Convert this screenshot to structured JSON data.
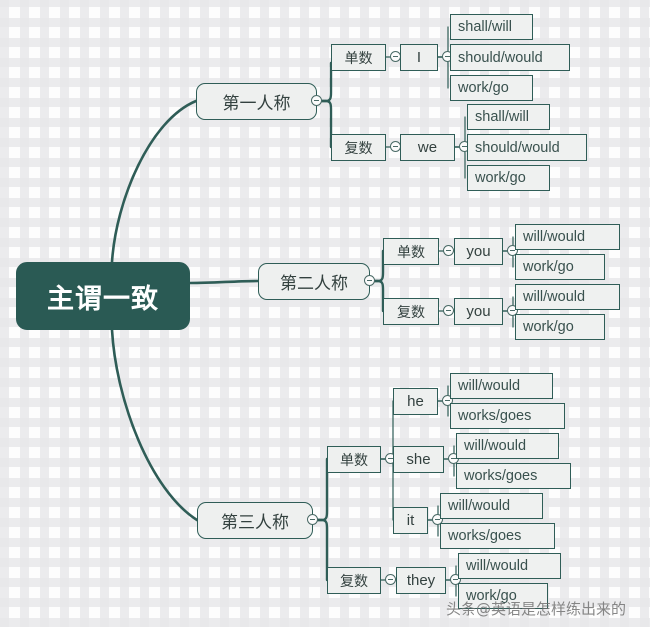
{
  "diagram": {
    "title": "主谓一致",
    "type": "mind-map",
    "colors": {
      "root_fill": "#2a5a54",
      "root_text": "#ffffff",
      "node_fill": "#eef0ef",
      "node_border": "#2f5d57",
      "node_text": "#33413f",
      "link": "#2f5d57",
      "background": "#fdfdfd"
    },
    "root": {
      "label": "主谓一致"
    },
    "branches": [
      {
        "label": "第一人称",
        "children": [
          {
            "label": "单数",
            "pronouns": [
              {
                "label": "I",
                "forms": [
                  "shall/will",
                  "should/would",
                  "work/go"
                ]
              }
            ]
          },
          {
            "label": "复数",
            "pronouns": [
              {
                "label": "we",
                "forms": [
                  "shall/will",
                  "should/would",
                  "work/go"
                ]
              }
            ]
          }
        ]
      },
      {
        "label": "第二人称",
        "children": [
          {
            "label": "单数",
            "pronouns": [
              {
                "label": "you",
                "forms": [
                  "will/would",
                  "work/go"
                ]
              }
            ]
          },
          {
            "label": "复数",
            "pronouns": [
              {
                "label": "you",
                "forms": [
                  "will/would",
                  "work/go"
                ]
              }
            ]
          }
        ]
      },
      {
        "label": "第三人称",
        "children": [
          {
            "label": "单数",
            "pronouns": [
              {
                "label": "he",
                "forms": [
                  "will/would",
                  "works/goes"
                ]
              },
              {
                "label": "she",
                "forms": [
                  "will/would",
                  "works/goes"
                ]
              },
              {
                "label": "it",
                "forms": [
                  "will/would",
                  "works/goes"
                ]
              }
            ]
          },
          {
            "label": "复数",
            "pronouns": [
              {
                "label": "they",
                "forms": [
                  "will/would",
                  "work/go"
                ]
              }
            ]
          }
        ]
      }
    ]
  },
  "watermark": {
    "text": "头条@英语是怎样练出来的"
  }
}
